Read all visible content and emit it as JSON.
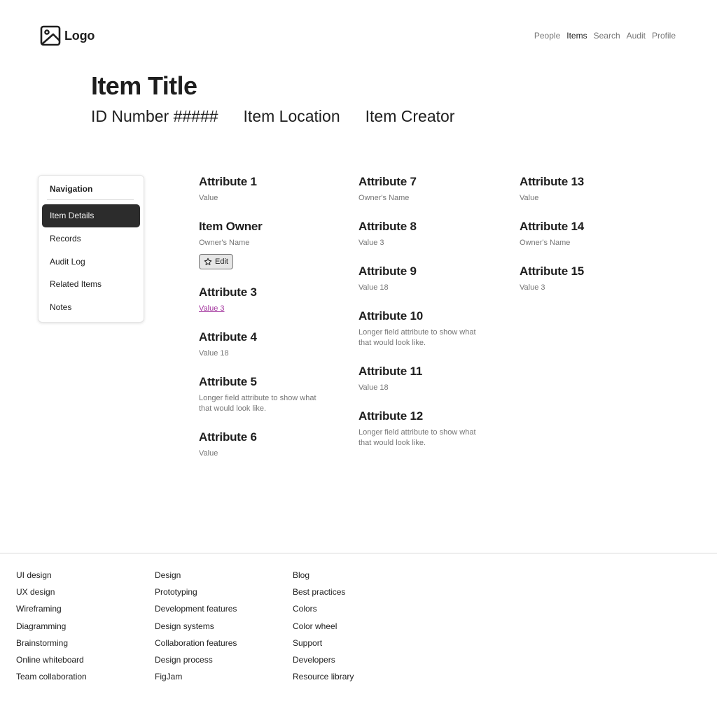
{
  "header": {
    "logo_text": "Logo",
    "logo_icon": "image-icon",
    "nav": [
      "People",
      "Items",
      "Search",
      "Audit",
      "Profile"
    ],
    "active_nav": "Items"
  },
  "item": {
    "title": "Item Title",
    "id": "ID Number #####",
    "location": "Item Location",
    "creator": "Item Creator"
  },
  "sidebar": {
    "heading": "Navigation",
    "items": [
      "Item Details",
      "Records",
      "Audit Log",
      "Related Items",
      "Notes"
    ],
    "active": "Item Details"
  },
  "attributes": {
    "col1": [
      {
        "label": "Attribute 1",
        "value": "Value"
      },
      {
        "label": "Item Owner",
        "value": "Owner's Name",
        "button": "Edit",
        "button_icon": "star-icon"
      },
      {
        "label": "Attribute 3",
        "value": "Value 3",
        "link": true
      },
      {
        "label": "Attribute 4",
        "value": "Value 18"
      },
      {
        "label": "Attribute 5",
        "value": "Longer field attribute to show what that would look like."
      },
      {
        "label": "Attribute 6",
        "value": "Value"
      }
    ],
    "col2": [
      {
        "label": "Attribute 7",
        "value": "Owner's Name"
      },
      {
        "label": "Attribute 8",
        "value": "Value 3"
      },
      {
        "label": "Attribute 9",
        "value": "Value 18"
      },
      {
        "label": "Attribute 10",
        "value": "Longer field attribute to show what that would look like."
      },
      {
        "label": "Attribute 11",
        "value": "Value 18"
      },
      {
        "label": "Attribute 12",
        "value": "Longer field attribute to show what that would look like."
      }
    ],
    "col3": [
      {
        "label": "Attribute 13",
        "value": "Value"
      },
      {
        "label": "Attribute 14",
        "value": "Owner's Name"
      },
      {
        "label": "Attribute 15",
        "value": "Value 3"
      }
    ]
  },
  "footer": {
    "col1": [
      "UI design",
      "UX design",
      "Wireframing",
      "Diagramming",
      "Brainstorming",
      "Online whiteboard",
      "Team collaboration"
    ],
    "col2": [
      "Design",
      "Prototyping",
      "Development features",
      "Design systems",
      "Collaboration features",
      "Design process",
      "FigJam"
    ],
    "col3": [
      "Blog",
      "Best practices",
      "Colors",
      "Color wheel",
      "Support",
      "Developers",
      "Resource library"
    ]
  },
  "colors": {
    "text": "#1e1e1e",
    "muted": "#757575",
    "link": "#a3369e",
    "nav_active_bg": "#2c2c2c"
  }
}
